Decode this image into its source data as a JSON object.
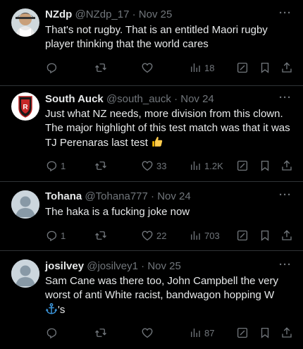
{
  "colors": {
    "background": "#000000",
    "text": "#e7e9ea",
    "secondary": "#71767b",
    "divider": "#2f3336"
  },
  "tweets": [
    {
      "name": "NZdp",
      "handle": "@NZdp_17",
      "sep": "·",
      "date": "Nov 25",
      "avatar": "photo-avatar",
      "text": "That's not rugby.  That is an entitled Maori rugby player thinking that the world cares",
      "reply_count": "",
      "retweet_count": "",
      "like_count": "",
      "views": "18"
    },
    {
      "name": "South Auck",
      "handle": "@south_auck",
      "sep": "·",
      "date": "Nov 24",
      "avatar": "crest-avatar",
      "text": "Just what NZ needs, more division from this clown. The major highlight of this test match was that it was TJ Perenaras last test ",
      "emoji": "thumbs-up",
      "reply_count": "1",
      "retweet_count": "",
      "like_count": "33",
      "views": "1.2K"
    },
    {
      "name": "Tohana",
      "handle": "@Tohana777",
      "sep": "·",
      "date": "Nov 24",
      "avatar": "default-avatar",
      "text": "The haka is a fucking joke now",
      "reply_count": "1",
      "retweet_count": "",
      "like_count": "22",
      "views": "703"
    },
    {
      "name": "josilvey",
      "handle": "@josilvey1",
      "sep": "·",
      "date": "Nov 25",
      "avatar": "default-avatar",
      "text_line1": "Sam Cane was there too, John Campbell the very worst of anti White racist, bandwagon hopping  W",
      "text_line2_suffix": "'s",
      "emoji": "anchor",
      "reply_count": "",
      "retweet_count": "",
      "like_count": "",
      "views": "87"
    }
  ]
}
